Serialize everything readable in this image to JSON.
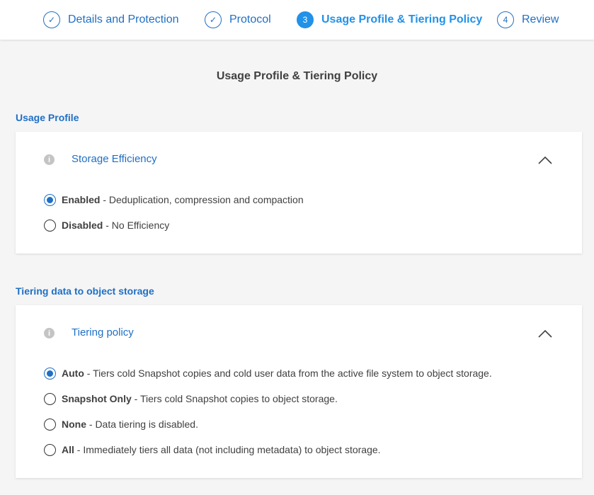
{
  "wizard": {
    "steps": [
      {
        "number": "✓",
        "label": "Details and Protection",
        "state": "done"
      },
      {
        "number": "✓",
        "label": "Protocol",
        "state": "done"
      },
      {
        "number": "3",
        "label": "Usage Profile & Tiering Policy",
        "state": "active"
      },
      {
        "number": "4",
        "label": "Review",
        "state": "future"
      }
    ]
  },
  "page_title": "Usage Profile & Tiering Policy",
  "usage_profile": {
    "section_title": "Usage Profile",
    "card_title": "Storage Efficiency",
    "info_glyph": "i",
    "expanded": true,
    "options": [
      {
        "name": "Enabled",
        "desc": " - Deduplication, compression and compaction",
        "checked": true
      },
      {
        "name": "Disabled",
        "desc": " - No Efficiency",
        "checked": false
      }
    ]
  },
  "tiering": {
    "section_title": "Tiering data to object storage",
    "card_title": "Tiering policy",
    "info_glyph": "i",
    "expanded": true,
    "options": [
      {
        "name": "Auto",
        "desc": " - Tiers cold Snapshot copies and cold user data from the active file system to object storage.",
        "checked": true
      },
      {
        "name": "Snapshot Only",
        "desc": " - Tiers cold Snapshot copies to object storage.",
        "checked": false
      },
      {
        "name": "None",
        "desc": " - Data tiering is disabled.",
        "checked": false
      },
      {
        "name": "All",
        "desc": " - Immediately tiers all data (not including metadata) to object storage.",
        "checked": false
      }
    ]
  },
  "colors": {
    "accent": "#1f6fc5",
    "active_step": "#2291e8",
    "background": "#f5f5f5",
    "text": "#404040"
  }
}
